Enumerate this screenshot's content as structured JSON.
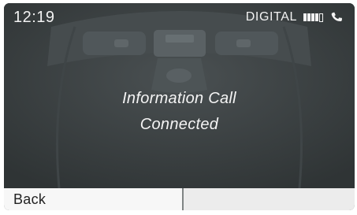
{
  "status_bar": {
    "time": "12:19",
    "network_label": "DIGITAL",
    "signal_strength": {
      "filled_bars": 4,
      "total_bars": 5
    },
    "call_icon": "phone-handset-icon"
  },
  "message": {
    "line1": "Information Call",
    "line2": "Connected"
  },
  "softkeys": {
    "left_label": "Back",
    "right_label": ""
  },
  "colors": {
    "screen_background": "#3a3f40",
    "text": "#f2f2f2",
    "softkey_background": "#f7f7f7"
  }
}
